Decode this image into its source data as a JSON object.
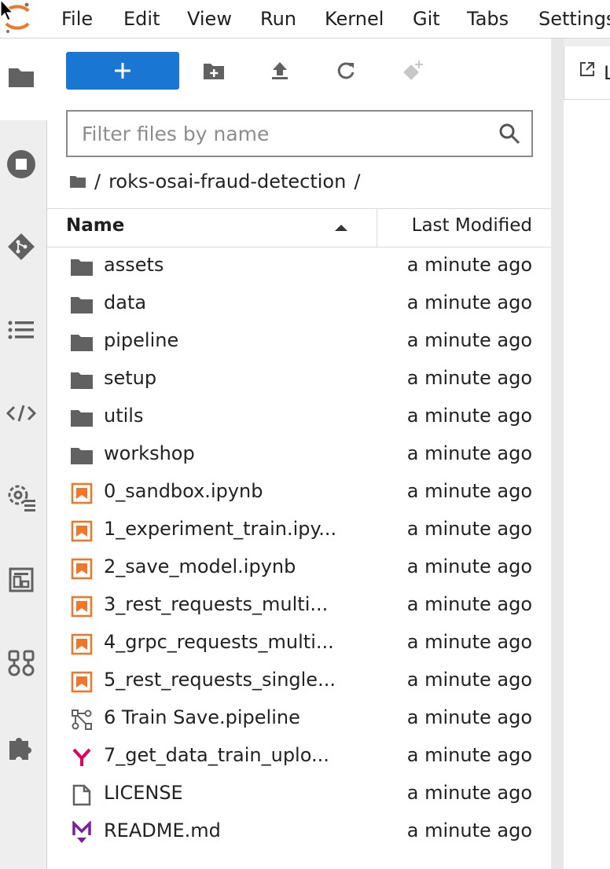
{
  "menu": {
    "items": [
      "File",
      "Edit",
      "View",
      "Run",
      "Kernel",
      "Git",
      "Tabs",
      "Settings"
    ]
  },
  "sidebar": {
    "icons": [
      "folder-icon",
      "running-kernels-icon",
      "git-icon",
      "table-of-contents-icon",
      "property-inspector-icon",
      "settings-icon",
      "extension-manager-icon",
      "pipeline-components-icon",
      "extensions-puzzle-icon"
    ]
  },
  "toolbar": {
    "new_launcher_icon": "plus-icon",
    "new_folder_icon": "new-folder-icon",
    "upload_icon": "upload-icon",
    "refresh_icon": "refresh-icon",
    "git_clone_icon": "git-clone-icon"
  },
  "filter": {
    "placeholder": "Filter files by name",
    "value": ""
  },
  "breadcrumb": {
    "separator": "/",
    "path": "roks-osai-fraud-detection",
    "trailing": "/"
  },
  "listing": {
    "columns": {
      "name": "Name",
      "modified": "Last Modified"
    },
    "files": [
      {
        "name": "assets",
        "type": "folder",
        "modified": "a minute ago"
      },
      {
        "name": "data",
        "type": "folder",
        "modified": "a minute ago"
      },
      {
        "name": "pipeline",
        "type": "folder",
        "modified": "a minute ago"
      },
      {
        "name": "setup",
        "type": "folder",
        "modified": "a minute ago"
      },
      {
        "name": "utils",
        "type": "folder",
        "modified": "a minute ago"
      },
      {
        "name": "workshop",
        "type": "folder",
        "modified": "a minute ago"
      },
      {
        "name": "0_sandbox.ipynb",
        "type": "notebook",
        "modified": "a minute ago"
      },
      {
        "name": "1_experiment_train.ipy...",
        "type": "notebook",
        "modified": "a minute ago"
      },
      {
        "name": "2_save_model.ipynb",
        "type": "notebook",
        "modified": "a minute ago"
      },
      {
        "name": "3_rest_requests_multi...",
        "type": "notebook",
        "modified": "a minute ago"
      },
      {
        "name": "4_grpc_requests_multi...",
        "type": "notebook",
        "modified": "a minute ago"
      },
      {
        "name": "5_rest_requests_single...",
        "type": "notebook",
        "modified": "a minute ago"
      },
      {
        "name": "6 Train Save.pipeline",
        "type": "pipeline",
        "modified": "a minute ago"
      },
      {
        "name": "7_get_data_train_uplo...",
        "type": "yaml",
        "modified": "a minute ago"
      },
      {
        "name": "LICENSE",
        "type": "file",
        "modified": "a minute ago"
      },
      {
        "name": "README.md",
        "type": "markdown",
        "modified": "a minute ago"
      }
    ]
  },
  "main": {
    "tab_label": "L"
  },
  "colors": {
    "accent": "#1976d2",
    "notebook": "#f37626",
    "yaml": "#e4005b",
    "markdown": "#7b1fa2",
    "icon_gray": "#616161"
  }
}
